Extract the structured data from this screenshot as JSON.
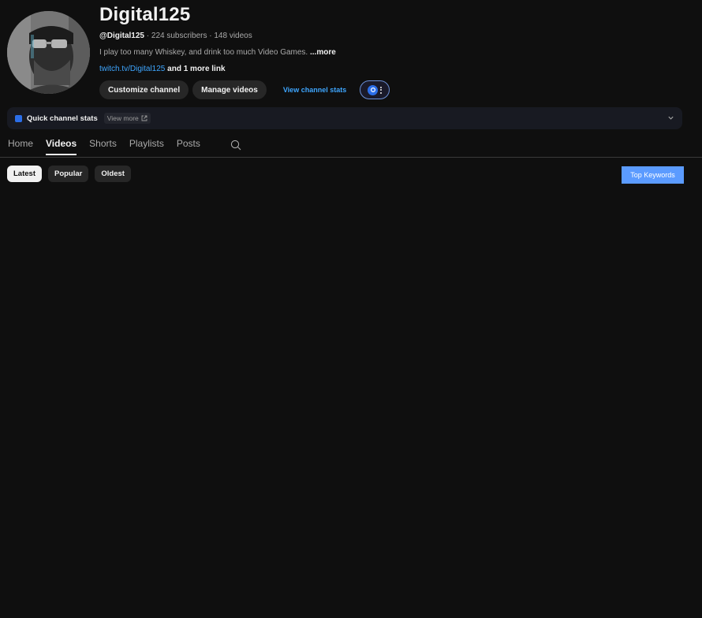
{
  "channel": {
    "name": "Digital125",
    "handle": "@Digital125",
    "stats": " · 224 subscribers · 148 videos",
    "description": "I play too many Whiskey, and drink too much Video Games. ",
    "description_more": "...more",
    "link_text": "twitch.tv/Digital125",
    "more_links": " and 1 more link"
  },
  "actions": {
    "customize": "Customize channel",
    "manage": "Manage videos",
    "view_stats": "View channel stats"
  },
  "quick_stats": {
    "title": "Quick channel stats",
    "view_more": "View more"
  },
  "tabs": [
    {
      "label": "Home",
      "active": false
    },
    {
      "label": "Videos",
      "active": true
    },
    {
      "label": "Shorts",
      "active": false
    },
    {
      "label": "Playlists",
      "active": false
    },
    {
      "label": "Posts",
      "active": false
    }
  ],
  "filters": [
    {
      "label": "Latest",
      "active": true
    },
    {
      "label": "Popular",
      "active": false
    },
    {
      "label": "Oldest",
      "active": false
    }
  ],
  "top_keywords": "Top Keywords",
  "icons": {
    "search": "search-icon",
    "chevron": "chevron-down-icon",
    "external": "external-link-icon",
    "more": "more-vert-icon"
  },
  "colors": {
    "background": "#0f0f0f",
    "link": "#3ea6ff",
    "chip": "#272727",
    "keyword_button": "#5b9bff"
  }
}
